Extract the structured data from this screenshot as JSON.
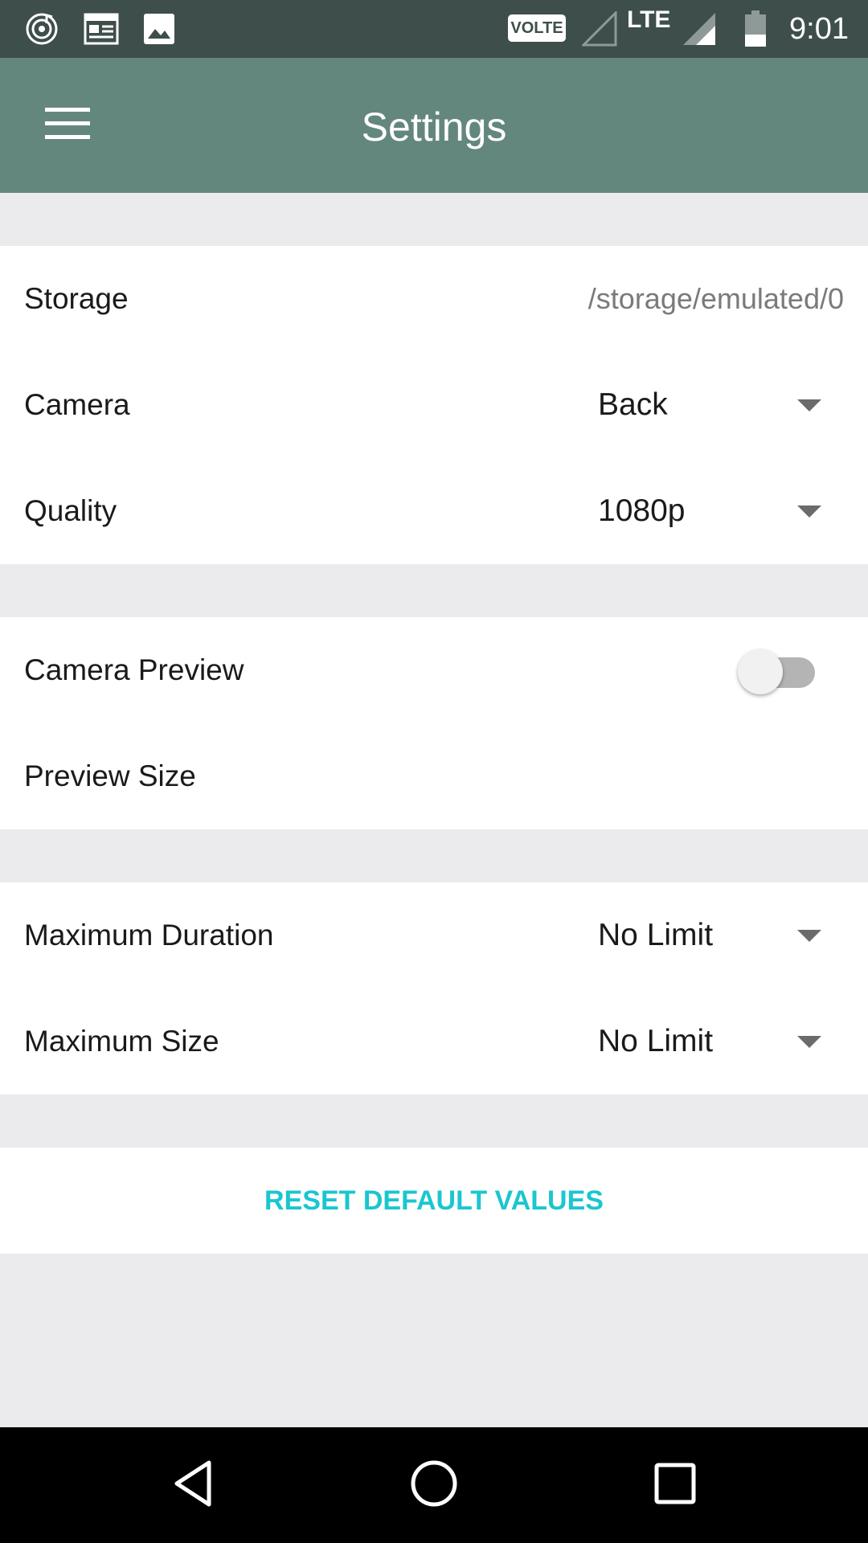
{
  "status_bar": {
    "time": "9:01",
    "volte": "VOLTE",
    "lte": "LTE",
    "icons": [
      "music-notification-icon",
      "news-notification-icon",
      "image-notification-icon",
      "signal-empty-icon",
      "signal-icon",
      "battery-icon"
    ]
  },
  "app_bar": {
    "title": "Settings",
    "background": "#64877d"
  },
  "settings": {
    "storage": {
      "label": "Storage",
      "value": "/storage/emulated/0"
    },
    "camera": {
      "label": "Camera",
      "value": "Back"
    },
    "quality": {
      "label": "Quality",
      "value": "1080p"
    },
    "camera_preview": {
      "label": "Camera Preview",
      "enabled": false
    },
    "preview_size": {
      "label": "Preview Size"
    },
    "max_duration": {
      "label": "Maximum Duration",
      "value": "No Limit"
    },
    "max_size": {
      "label": "Maximum Size",
      "value": "No Limit"
    }
  },
  "reset": {
    "label": "RESET DEFAULT VALUES",
    "color": "#1ac6d0"
  },
  "nav_bar": {
    "icons": [
      "back-icon",
      "home-icon",
      "recents-icon"
    ]
  }
}
